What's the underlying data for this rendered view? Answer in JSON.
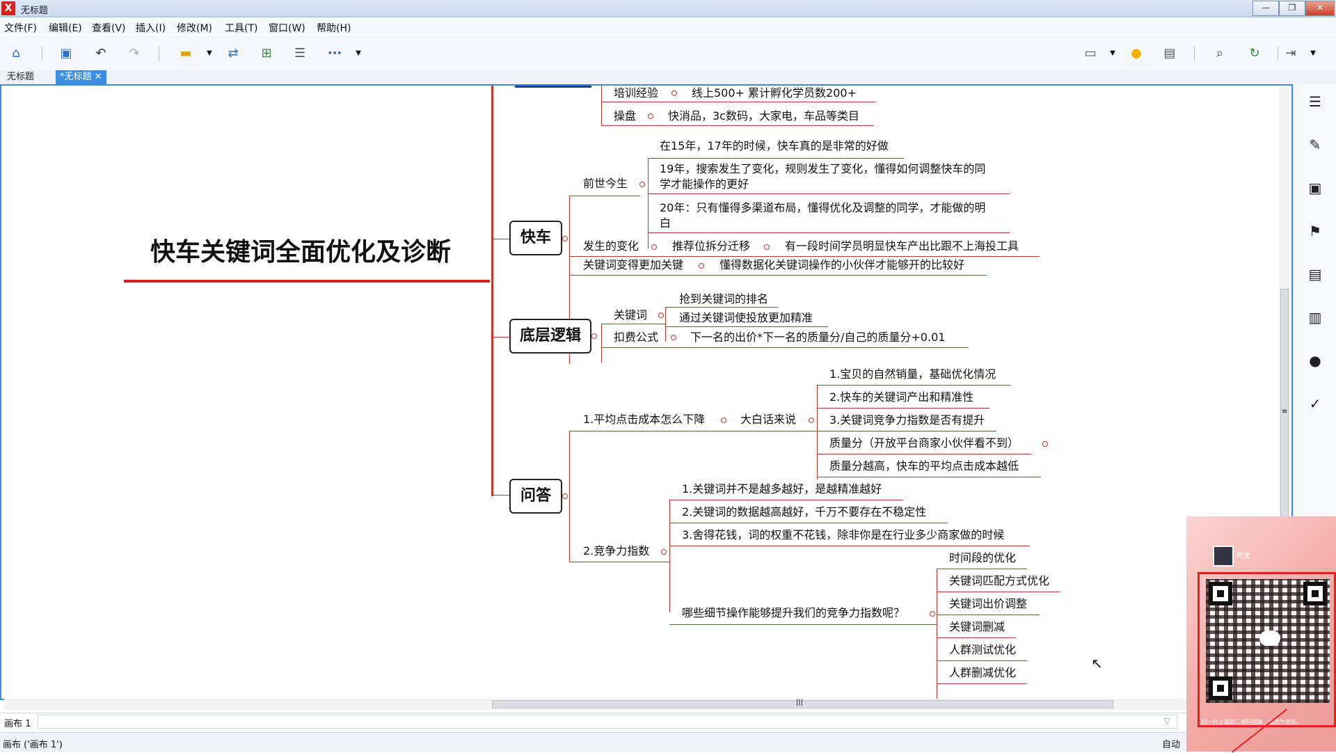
{
  "window": {
    "title": "无标题",
    "logo": "X",
    "min": "—",
    "restore": "❐",
    "close": "✕"
  },
  "menu": [
    "文件(F)",
    "编辑(E)",
    "查看(V)",
    "插入(I)",
    "修改(M)",
    "工具(T)",
    "窗口(W)",
    "帮助(H)"
  ],
  "tabs": [
    "无标题",
    "*无标题",
    "✕"
  ],
  "toolbar": {
    "more": "···"
  },
  "mindmap": {
    "central": "快车关键词全面优化及诊断",
    "top_rows": [
      {
        "label": "培训经验",
        "value": "线上500+   累计孵化学员数200+"
      },
      {
        "label": "操盘",
        "value": "快消品，3c数码，大家电，车品等类目"
      }
    ],
    "kuaiche": {
      "title": "快车",
      "qianshi": "前世今生",
      "qianshi_items": [
        "在15年，17年的时候，快车真的是非常的好做",
        "19年，搜索发生了变化，规则发生了变化，懂得如何调整快车的同",
        "学才能操作的更好",
        "20年：只有懂得多渠道布局，懂得优化及调整的同学，才能做的明",
        "白"
      ],
      "change_label": "发生的变化",
      "change_mid": "推荐位拆分迁移",
      "change_value": "有一段时间学员明显快车产出比跟不上海投工具",
      "key_label": "关键词变得更加关键",
      "key_value": "懂得数据化关键词操作的小伙伴才能够开的比较好"
    },
    "logic": {
      "title": "底层逻辑",
      "kw_label": "关键词",
      "kw_items": [
        "抢到关键词的排名",
        "通过关键词使投放更加精准"
      ],
      "fee_label": "扣费公式",
      "fee_value": "下一名的出价*下一名的质量分/自己的质量分+0.01"
    },
    "qa": {
      "title": "问答",
      "q1": "1.平均点击成本怎么下降",
      "q1_mid": "大白话来说",
      "q1_items": [
        "1.宝贝的自然销量，基础优化情况",
        "2.快车的关键词产出和精准性",
        "3.关键词竞争力指数是否有提升",
        "质量分（开放平台商家小伙伴看不到）",
        "质量分越高，快车的平均点击成本越低"
      ],
      "q2": "2.竞争力指数",
      "q2_items": [
        "1.关键词并不是越多越好，是越精准越好",
        "2.关键词的数据越高越好，千万不要存在不稳定性",
        "3.舍得花钱，词的权重不花钱，除非你是在行业多少商家做的时候"
      ],
      "q2_question": "哪些细节操作能够提升我们的竞争力指数呢？",
      "q2_detail": [
        "时间段的优化",
        "关键词匹配方式优化",
        "关键词出价调整",
        "关键词删减",
        "人群测试优化",
        "人群删减优化"
      ]
    }
  },
  "sheet_tab": "画布 1",
  "status": {
    "left": "画布 ('画布 1')",
    "right": "自动"
  },
  "overlay": {
    "user": "阿宝",
    "caption": "扫一扫上面的二维码图案，加我为朋友。"
  },
  "hscroll_grip": "|||",
  "vscroll_grip": "≡"
}
